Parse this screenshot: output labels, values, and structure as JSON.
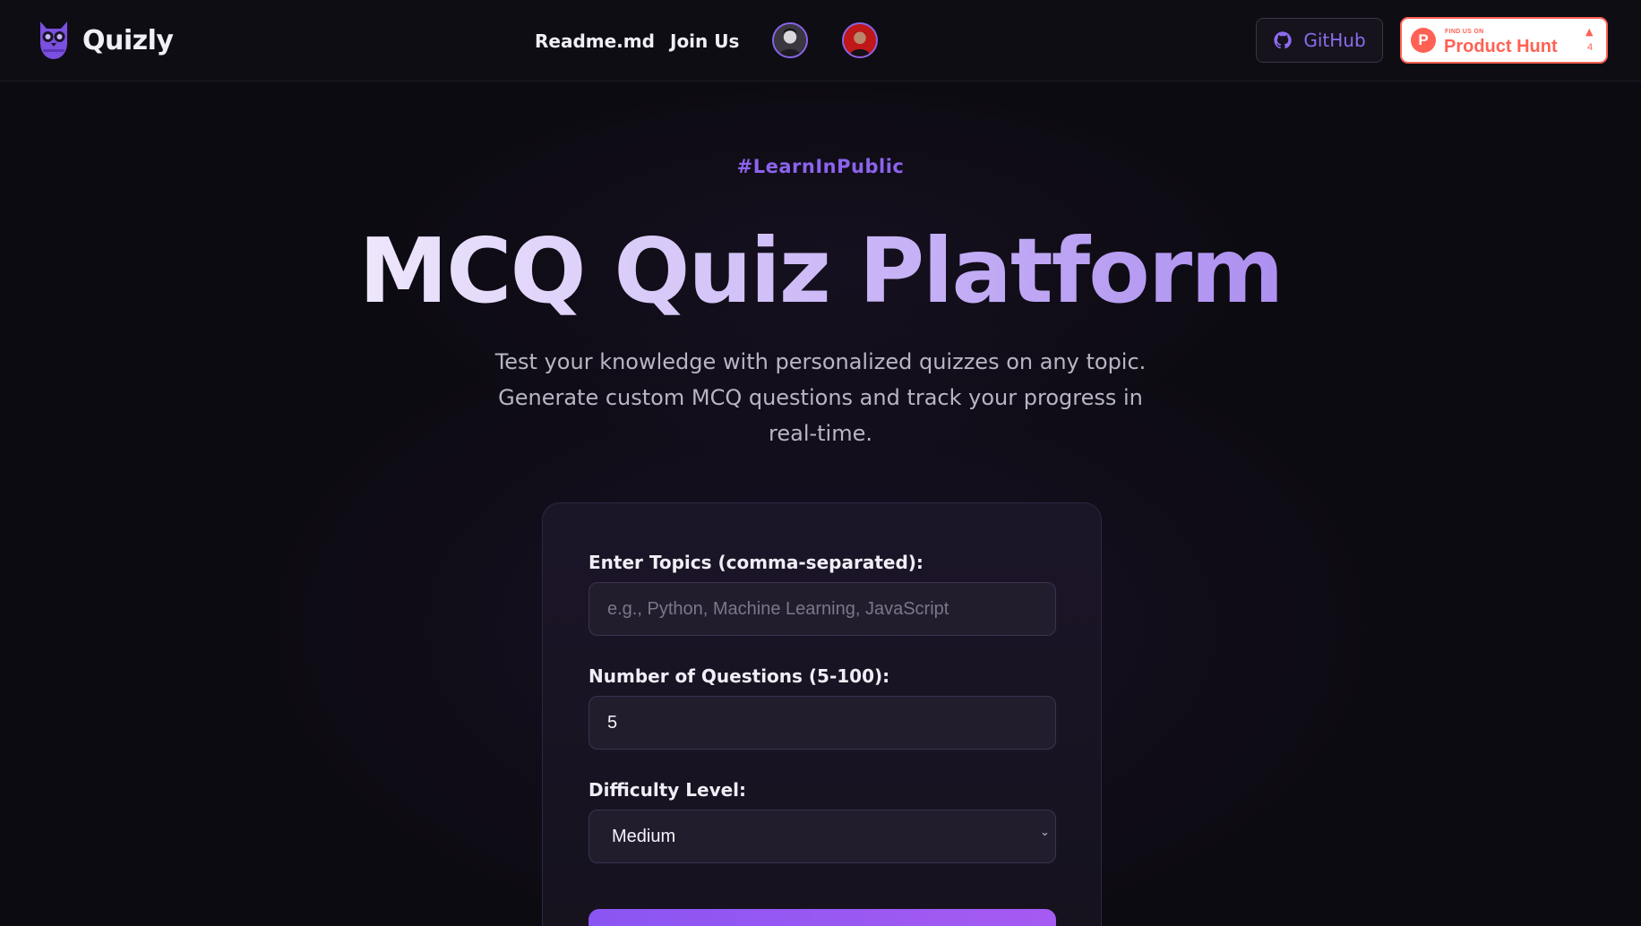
{
  "brand": {
    "name": "Quizly",
    "logo_icon": "owl-icon"
  },
  "nav": {
    "links": [
      "Readme.md",
      "Join Us"
    ],
    "avatars": [
      "contributor-avatar-1",
      "contributor-avatar-2"
    ],
    "github_label": "GitHub",
    "product_hunt": {
      "small": "FIND US ON",
      "big": "Product Hunt",
      "count": "4"
    }
  },
  "hero": {
    "tag": "#LearnInPublic",
    "title": "MCQ Quiz Platform",
    "subtitle": "Test your knowledge with personalized quizzes on any topic. Generate custom MCQ questions and track your progress in real-time."
  },
  "form": {
    "topics_label": "Enter Topics (comma-separated):",
    "topics_placeholder": "e.g., Python, Machine Learning, JavaScript",
    "topics_value": "",
    "count_label": "Number of Questions (5-100):",
    "count_value": "5",
    "difficulty_label": "Difficulty Level:",
    "difficulty_value": "Medium"
  },
  "colors": {
    "accent": "#8c63ee",
    "product_hunt": "#ff6154",
    "background": "#0d0b12"
  }
}
